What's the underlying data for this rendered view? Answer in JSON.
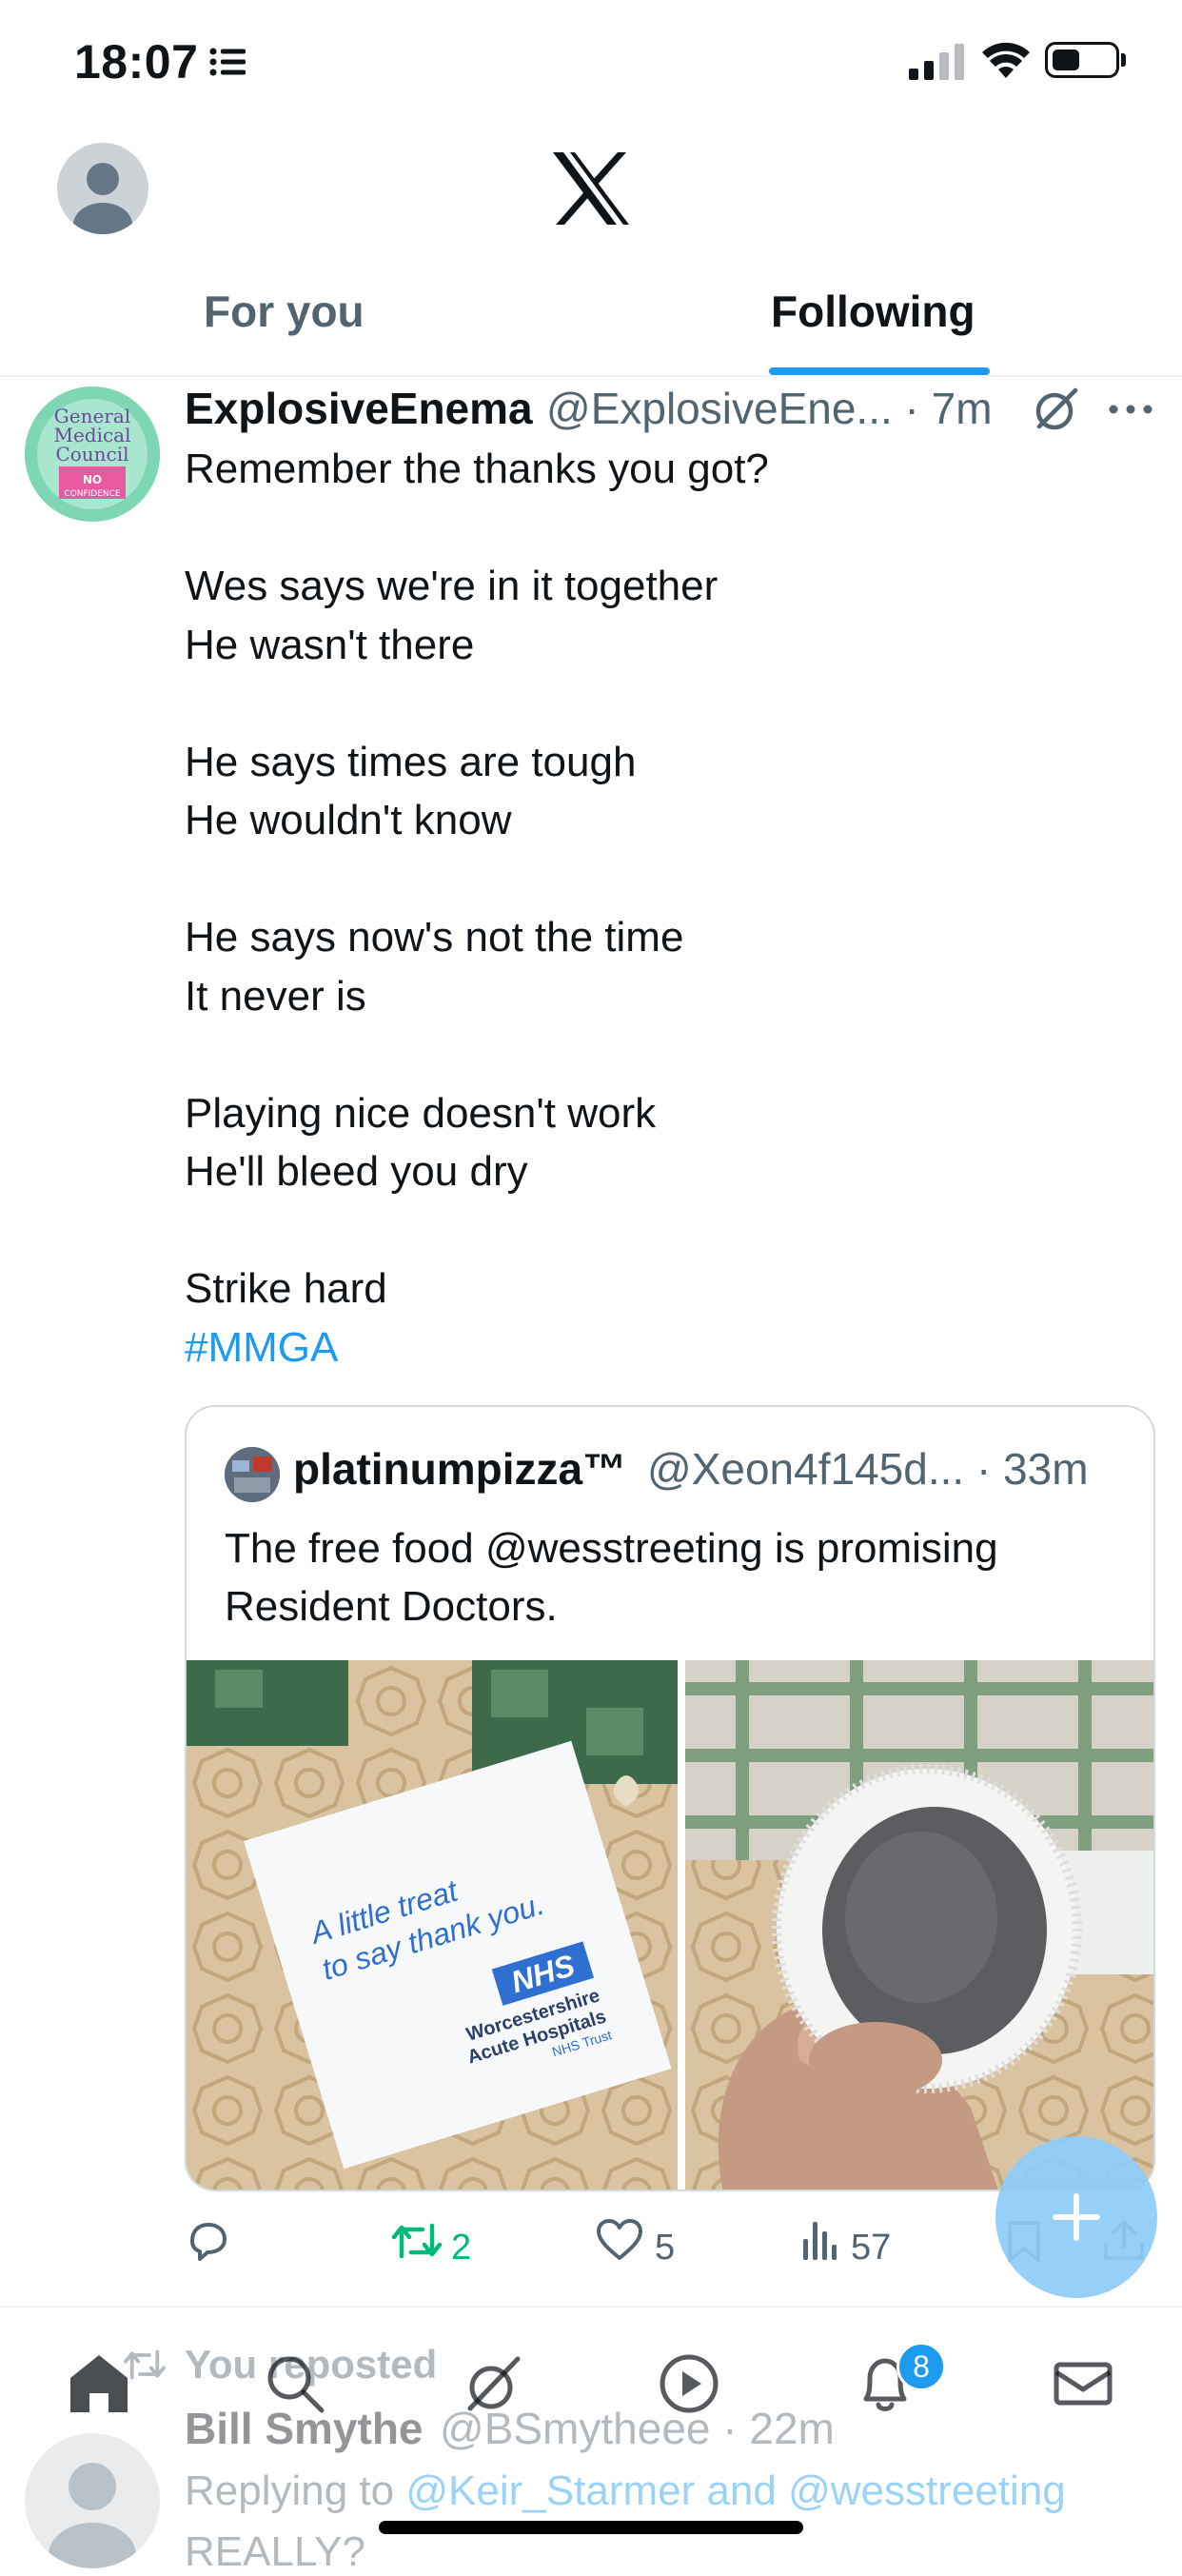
{
  "status_bar": {
    "time": "18:07"
  },
  "header": {
    "tabs": [
      {
        "label": "For you",
        "active": false
      },
      {
        "label": "Following",
        "active": true
      }
    ],
    "accent_color": "#1d9bf0"
  },
  "tweet": {
    "author_name": "ExplosiveEnema",
    "author_handle": "@ExplosiveEne...",
    "time": "· 7m",
    "text": "Remember the thanks you got?\n\nWes says we're in it together\nHe wasn't there\n\nHe says times are tough\nHe wouldn't know\n\nHe says now's not the time\nIt never is\n\nPlaying nice doesn't work\nHe'll bleed you dry\n\nStrike hard",
    "hashtag": "#MMGA",
    "avatar_text": [
      "General",
      "Medical",
      "Council",
      "NO",
      "CONFIDENCE"
    ],
    "quote": {
      "author_name": "platinumpizza™",
      "author_handle": "@Xeon4f145d...",
      "time": "· 33m",
      "text": "The free food @wesstreeting is promising Resident Doctors.",
      "card_lines": [
        "A little treat",
        "to say thank you."
      ],
      "card_nhs": "NHS",
      "card_org": [
        "Worcestershire",
        "Acute Hospitals",
        "NHS Trust"
      ]
    },
    "actions": {
      "replies": "",
      "reposts": "2",
      "likes": "5",
      "views": "57"
    }
  },
  "next_tweet": {
    "repost_label": "You reposted",
    "author_name": "Bill Smythe",
    "author_handle": "@BSmytheee",
    "time": "· 22m",
    "replying_prefix": "Replying to",
    "replying_to": "@Keir_Starmer and @wesstreeting",
    "snippet": "REALLY?"
  },
  "bottom_nav": {
    "items": [
      "home-icon",
      "search-icon",
      "grok-icon",
      "media-icon",
      "notifications-icon",
      "messages-icon"
    ],
    "notification_count": "8"
  }
}
